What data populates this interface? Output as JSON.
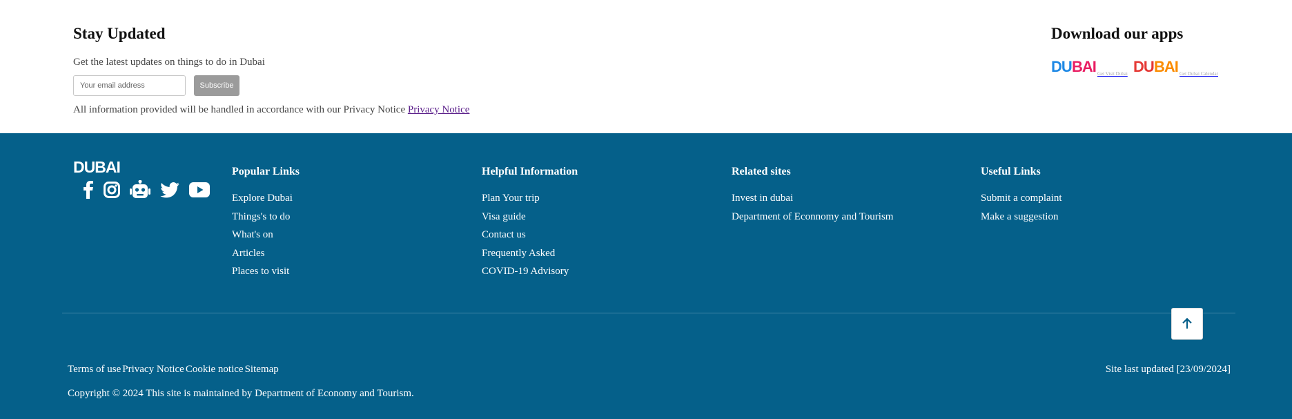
{
  "newsletter": {
    "title": "Stay Updated",
    "subtitle": "Get the latest updates on things to do in Dubai",
    "email_placeholder": "Your email address",
    "subscribe_label": "Subscribe",
    "privacy_text": "All information provided will be handled in accordance with our Privacy Notice ",
    "privacy_link": "Privacy Notice"
  },
  "apps": {
    "title": "Download our apps",
    "items": [
      {
        "logo_text": "DUBAI",
        "caption": "Get Visit Dubai",
        "colors": [
          "#1e88e5",
          "#e91e63"
        ]
      },
      {
        "logo_text": "DUBAI",
        "caption": "Get Dubai Calendar",
        "colors": [
          "#e53935",
          "#fb8c00"
        ]
      }
    ]
  },
  "footer": {
    "logo_text": "DUBAI",
    "social_icons": [
      "facebook-icon",
      "instagram-icon",
      "chatbot-icon",
      "twitter-icon",
      "youtube-icon"
    ],
    "columns": [
      {
        "title": "Popular Links",
        "links": [
          "Explore Dubai",
          "Things's to do",
          "What's on",
          "Articles",
          "Places to visit"
        ]
      },
      {
        "title": "Helpful Information",
        "links": [
          "Plan Your trip",
          "Visa guide",
          "Contact us",
          "Frequently Asked",
          "COVID-19 Advisory"
        ]
      },
      {
        "title": "Related sites",
        "links": [
          "Invest in dubai",
          "Department of Econnomy and Tourism"
        ]
      },
      {
        "title": "Useful Links",
        "links": [
          "Submit a complaint",
          "Make a suggestion"
        ]
      }
    ],
    "legal_links": [
      "Terms of use",
      "Privacy Notice",
      "Cookie notice",
      "Sitemap"
    ],
    "last_updated": "Site last updated [23/09/2024]",
    "copyright": "Copyright © 2024 This site is maintained by Department of Economy and Tourism.",
    "background": "#05608a"
  }
}
